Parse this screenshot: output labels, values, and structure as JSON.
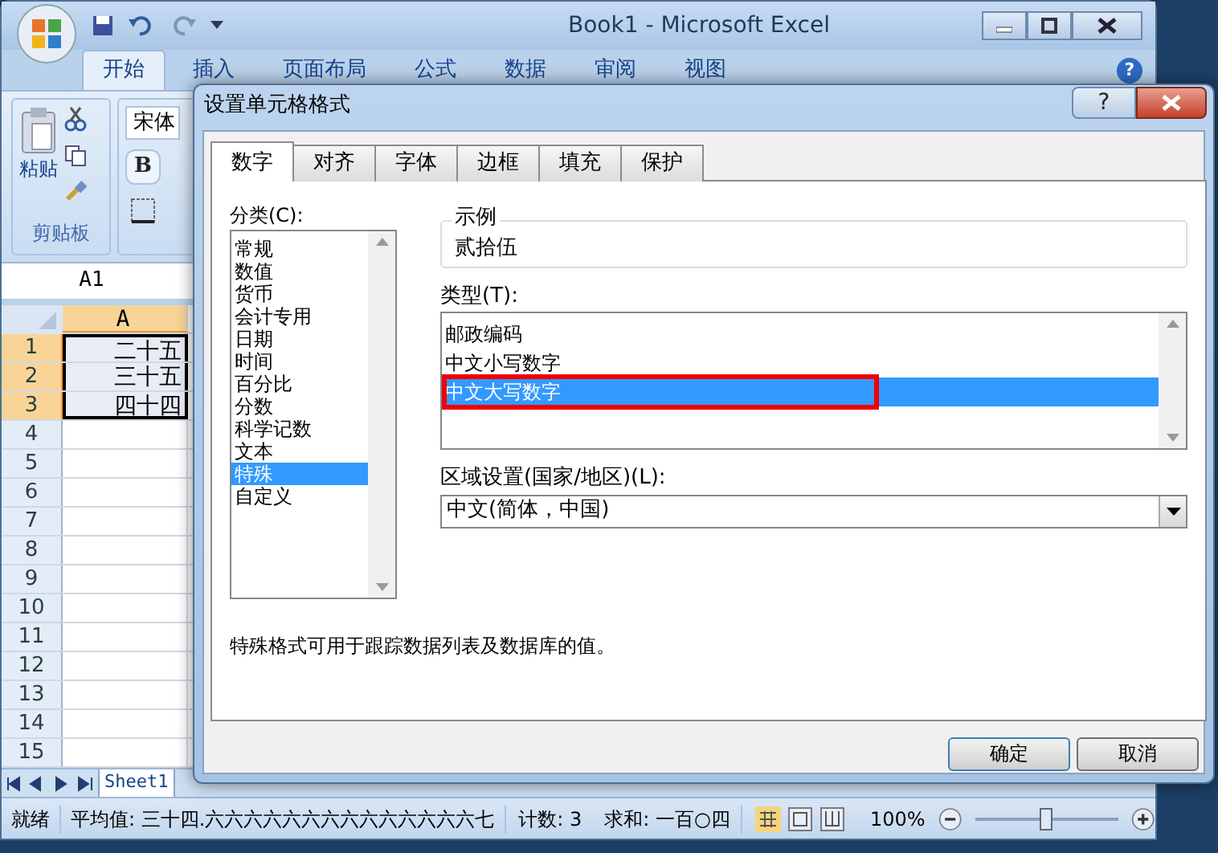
{
  "excel": {
    "title": "Book1 - Microsoft Excel",
    "help": "?",
    "ribbon_tabs": [
      {
        "label": "开始",
        "selected": true
      },
      {
        "label": "插入",
        "selected": false
      },
      {
        "label": "页面布局",
        "selected": false
      },
      {
        "label": "公式",
        "selected": false
      },
      {
        "label": "数据",
        "selected": false
      },
      {
        "label": "审阅",
        "selected": false
      },
      {
        "label": "视图",
        "selected": false
      }
    ],
    "paste_label": "粘贴",
    "clipboard_group": "剪贴板",
    "font_name": "宋体",
    "bold_key": "B",
    "name_box": "A1",
    "column_header": "A",
    "rows": [
      {
        "number": "1",
        "value": "二十五",
        "selected": true
      },
      {
        "number": "2",
        "value": "三十五",
        "selected": true
      },
      {
        "number": "3",
        "value": "四十四",
        "selected": true
      },
      {
        "number": "4",
        "selected": false
      },
      {
        "number": "5",
        "selected": false
      },
      {
        "number": "6",
        "selected": false
      },
      {
        "number": "7",
        "selected": false
      },
      {
        "number": "8",
        "selected": false
      },
      {
        "number": "9",
        "selected": false
      },
      {
        "number": "10",
        "selected": false
      },
      {
        "number": "11",
        "selected": false
      },
      {
        "number": "12",
        "selected": false
      },
      {
        "number": "13",
        "selected": false
      },
      {
        "number": "14",
        "selected": false
      },
      {
        "number": "15",
        "selected": false
      }
    ],
    "sheet_tabs": [
      {
        "label": "Sheet1",
        "selected": true
      }
    ],
    "status_bar": {
      "state": "就绪",
      "average": "平均值: 三十四.六六六六六六六六六六六六六六七",
      "count": "计数: 3",
      "sum": "求和: 一百○四",
      "zoom": "100%",
      "zoom_slider": {
        "level": 0.5
      }
    }
  },
  "dialog": {
    "title": "设置单元格格式",
    "help": "?",
    "tabs": [
      {
        "label": "数字",
        "selected": true
      },
      {
        "label": "对齐",
        "selected": false
      },
      {
        "label": "字体",
        "selected": false
      },
      {
        "label": "边框",
        "selected": false
      },
      {
        "label": "填充",
        "selected": false
      },
      {
        "label": "保护",
        "selected": false
      }
    ],
    "category_label": "分类(C):",
    "categories": [
      {
        "label": "常规",
        "selected": false
      },
      {
        "label": "数值",
        "selected": false
      },
      {
        "label": "货币",
        "selected": false
      },
      {
        "label": "会计专用",
        "selected": false
      },
      {
        "label": "日期",
        "selected": false
      },
      {
        "label": "时间",
        "selected": false
      },
      {
        "label": "百分比",
        "selected": false
      },
      {
        "label": "分数",
        "selected": false
      },
      {
        "label": "科学记数",
        "selected": false
      },
      {
        "label": "文本",
        "selected": false
      },
      {
        "label": "特殊",
        "selected": true
      },
      {
        "label": "自定义",
        "selected": false
      }
    ],
    "sample_label": "示例",
    "sample_value": "贰拾伍",
    "type_label": "类型(T):",
    "types": [
      {
        "label": "邮政编码",
        "selected": false
      },
      {
        "label": "中文小写数字",
        "selected": false
      },
      {
        "label": "中文大写数字",
        "selected": true
      }
    ],
    "locale_label": "区域设置(国家/地区)(L):",
    "locale_value": "中文(简体，中国)",
    "description": "特殊格式可用于跟踪数据列表及数据库的值。",
    "buttons": [
      "确定",
      "取消"
    ]
  }
}
